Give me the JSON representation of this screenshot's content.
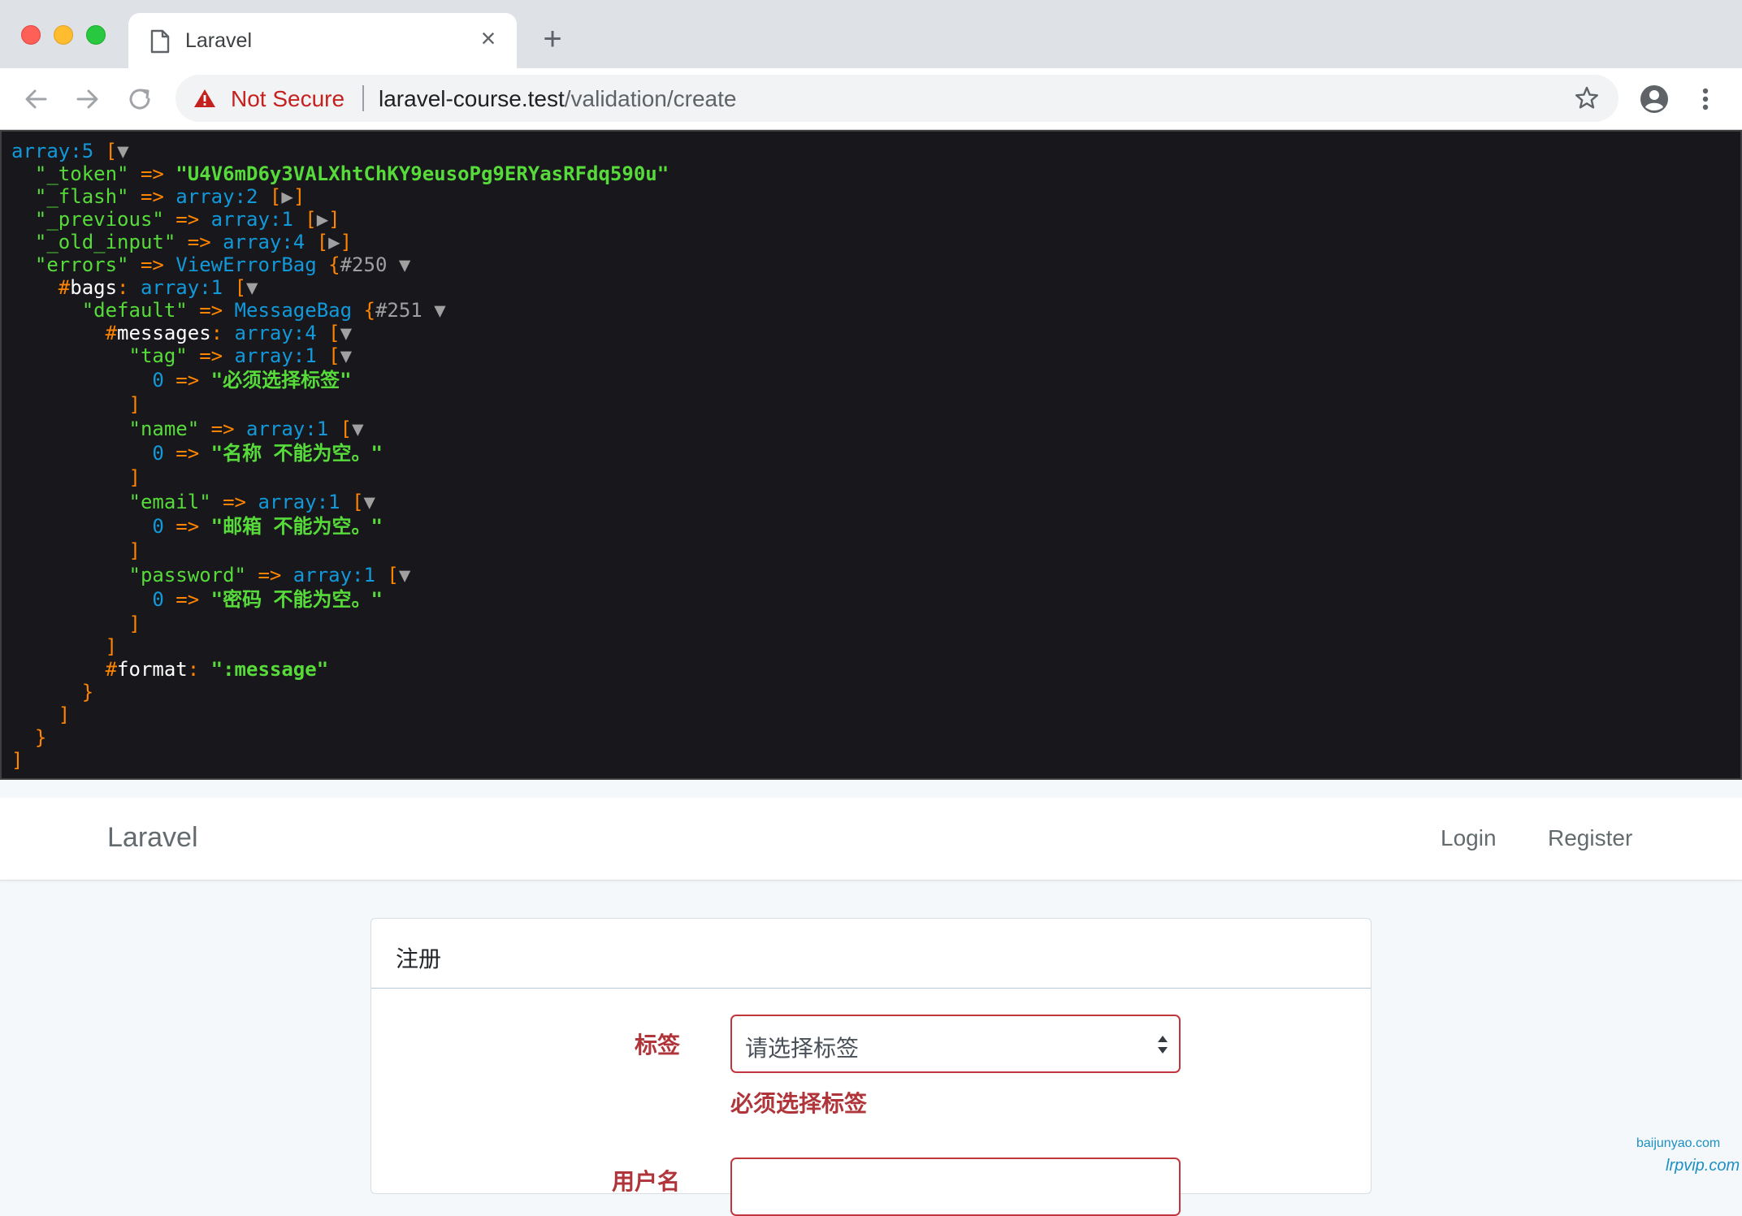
{
  "browser": {
    "tab_title": "Laravel",
    "new_tab_symbol": "+",
    "close_symbol": "×",
    "security_label": "Not Secure",
    "url_host": "laravel-course.test",
    "url_path": "/validation/create"
  },
  "dump": {
    "line1": {
      "type": "array:5",
      "open": " [",
      "toggle": "▼"
    },
    "token_key": "\"_token\"",
    "token_value": "\"U4V6mD6y3VALXhtChKY9eusoPg9ERYasRFdq590u\"",
    "flash_key": "\"_flash\"",
    "flash_type": "array:2",
    "previous_key": "\"_previous\"",
    "previous_type": "array:1",
    "old_input_key": "\"_old_input\"",
    "old_input_type": "array:4",
    "errors_key": "\"errors\"",
    "errors_class": "ViewErrorBag",
    "errors_ref": "#250",
    "bags_name": "bags",
    "bags_type": "array:1",
    "default_key": "\"default\"",
    "default_class": "MessageBag",
    "default_ref": "#251",
    "messages_name": "messages",
    "messages_type": "array:4",
    "tag_key": "\"tag\"",
    "tag_type": "array:1",
    "tag_msg": "\"必须选择标签\"",
    "name_key": "\"name\"",
    "name_type": "array:1",
    "name_msg": "\"名称 不能为空。\"",
    "email_key": "\"email\"",
    "email_type": "array:1",
    "email_msg": "\"邮箱 不能为空。\"",
    "password_key": "\"password\"",
    "password_type": "array:1",
    "password_msg": "\"密码 不能为空。\"",
    "format_name": "format",
    "format_value": "\":message\"",
    "index": "0",
    "arrow": " => ",
    "open_bracket": "[",
    "close_bracket": "]",
    "open_brace": "{",
    "close_brace": "}",
    "toggle_open": "▼",
    "toggle_closed": "▶",
    "hash": "#",
    "colon": ": "
  },
  "app": {
    "brand": "Laravel",
    "login": "Login",
    "register": "Register"
  },
  "form": {
    "card_title": "注册",
    "tag_label": "标签",
    "tag_placeholder": "请选择标签",
    "tag_error": "必须选择标签",
    "name_label": "用户名"
  },
  "watermarks": {
    "line1": "baijunyao.com",
    "line2": "lrpvip.com"
  },
  "colors": {
    "error_red": "#b0353a",
    "dump_bg": "#18171b",
    "dump_green": "#56db3a",
    "dump_orange": "#ff8400",
    "dump_blue": "#1299da"
  }
}
